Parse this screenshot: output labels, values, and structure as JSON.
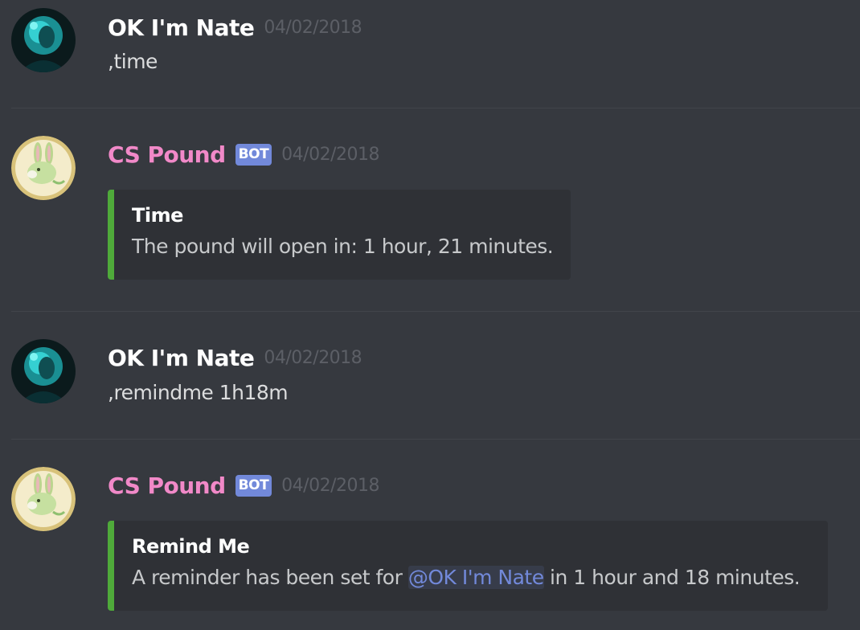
{
  "colors": {
    "background": "#36393f",
    "embed_bg": "#2f3136",
    "embed_accent": "#4faa3a",
    "bot_name": "#f189c8",
    "bot_tag": "#7289da",
    "mention": "#7289da"
  },
  "messages": [
    {
      "author": "OK I'm Nate",
      "timestamp": "04/02/2018",
      "text": ",time",
      "avatar_icon": "user-avatar-teal"
    },
    {
      "author": "CS Pound",
      "bot_tag": "BOT",
      "timestamp": "04/02/2018",
      "avatar_icon": "bunny-avatar",
      "embed": {
        "title": "Time",
        "description": "The pound will open in: 1 hour, 21 minutes."
      }
    },
    {
      "author": "OK I'm Nate",
      "timestamp": "04/02/2018",
      "text": ",remindme 1h18m",
      "avatar_icon": "user-avatar-teal"
    },
    {
      "author": "CS Pound",
      "bot_tag": "BOT",
      "timestamp": "04/02/2018",
      "avatar_icon": "bunny-avatar",
      "embed": {
        "title": "Remind Me",
        "description_prefix": "A reminder has been set for ",
        "mention": "@OK I'm Nate",
        "description_suffix": " in 1 hour and 18 minutes."
      }
    }
  ]
}
